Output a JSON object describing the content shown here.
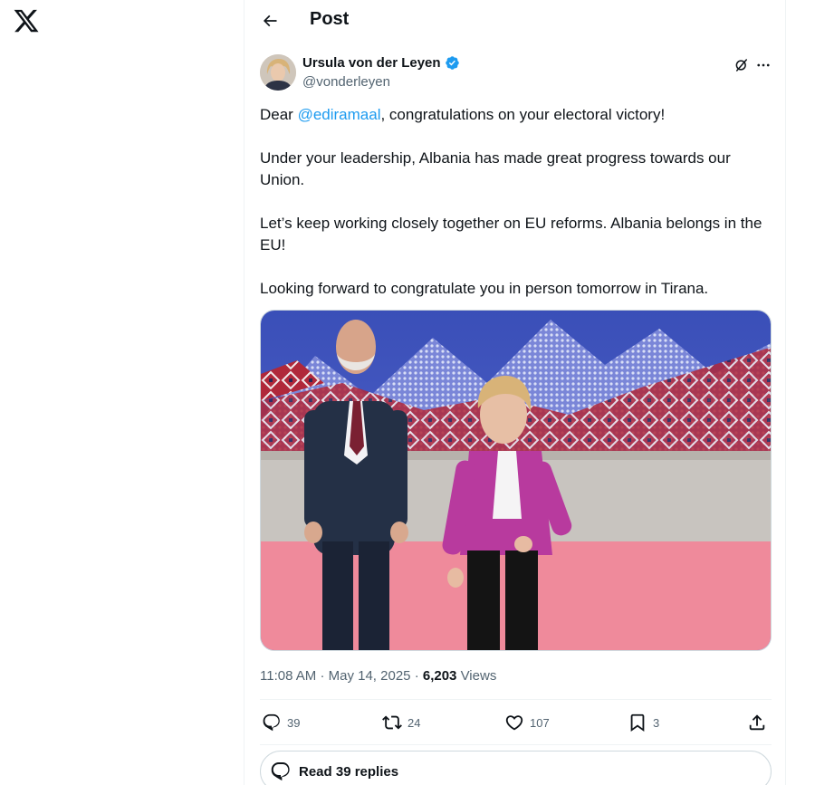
{
  "app": {
    "logo_icon": "x-logo-icon"
  },
  "header": {
    "title": "Post",
    "back_icon": "arrow-left-icon"
  },
  "author": {
    "name": "Ursula von der Leyen",
    "handle": "@vonderleyen",
    "verified_icon": "verified-badge-icon",
    "verified_color": "#1d9bf0"
  },
  "tweet": {
    "line1_prefix": "Dear ",
    "mention": "@ediramaal",
    "line1_suffix": ", congratulations on your electoral victory!",
    "para2": "Under your leadership, Albania has made great progress towards our Union.",
    "para3": "Let’s keep working closely together on EU reforms. Albania belongs in the EU!",
    "para4": "Looking forward to congratulate you in person tomorrow in Tirana.",
    "link_color": "#1d9bf0"
  },
  "meta": {
    "time": "11:08 AM",
    "separator": "·",
    "date": "May 14, 2025",
    "views_count": "6,203",
    "views_label": "Views"
  },
  "actions": {
    "replies": "39",
    "reposts": "24",
    "likes": "107",
    "bookmarks": "3"
  },
  "read_replies": {
    "label": "Read 39 replies"
  }
}
